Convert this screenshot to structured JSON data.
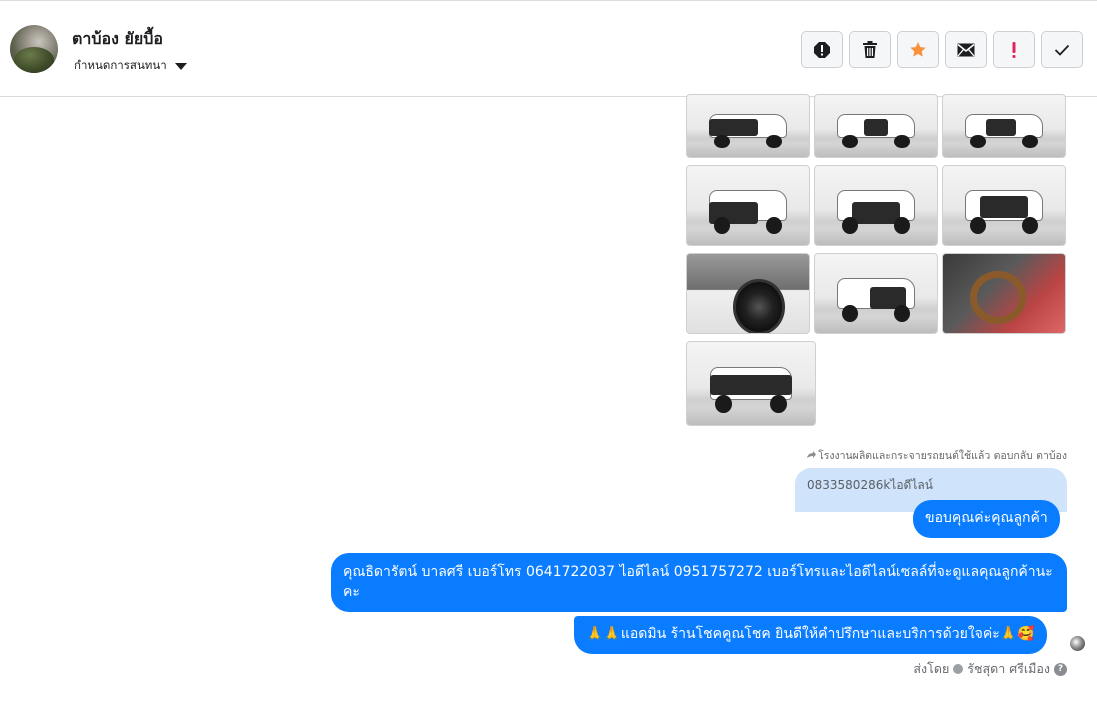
{
  "header": {
    "contact_name": "ตาบ้อง ยัยบื้อ",
    "assign_label": "กำหนดการสนทนา",
    "toolbar": [
      {
        "name": "report-icon",
        "label": "Report"
      },
      {
        "name": "trash-icon",
        "label": "Delete"
      },
      {
        "name": "star-icon",
        "label": "Star"
      },
      {
        "name": "mail-icon",
        "label": "Mark unread"
      },
      {
        "name": "exclamation-icon",
        "label": "Important"
      },
      {
        "name": "check-icon",
        "label": "Done"
      }
    ],
    "colors": {
      "star": "#f7923a",
      "exclamation": "#e0245e",
      "accent": "#0a7cff"
    }
  },
  "messages": {
    "reply_meta": "โรงงานผลิตและกระจายรถยนต์ใช้แล้ว ตอบกลับ ตาบ้อง",
    "quoted_text": "0833580286kไอดีไลน์",
    "bubble_1": "ขอบคุณค่ะคุณลูกค้า",
    "bubble_2": "คุณธิดารัตน์ บาลศรี เบอร์โทร 0641722037  ไอดีไลน์ 0951757272   เบอร์โทรและไอดีไลน์เซลล์ที่จะดูแลคุณลูกค้านะคะ",
    "bubble_3": "🙏🙏แอดมิน ร้านโชคคูณโชค ยินดีให้คำปรึกษาและบริการด้วยใจค่ะ🙏🥰",
    "sent_by_label": "ส่งโดย",
    "sender_name": "รัชสุดา ศรีเมือง",
    "help": "?"
  }
}
